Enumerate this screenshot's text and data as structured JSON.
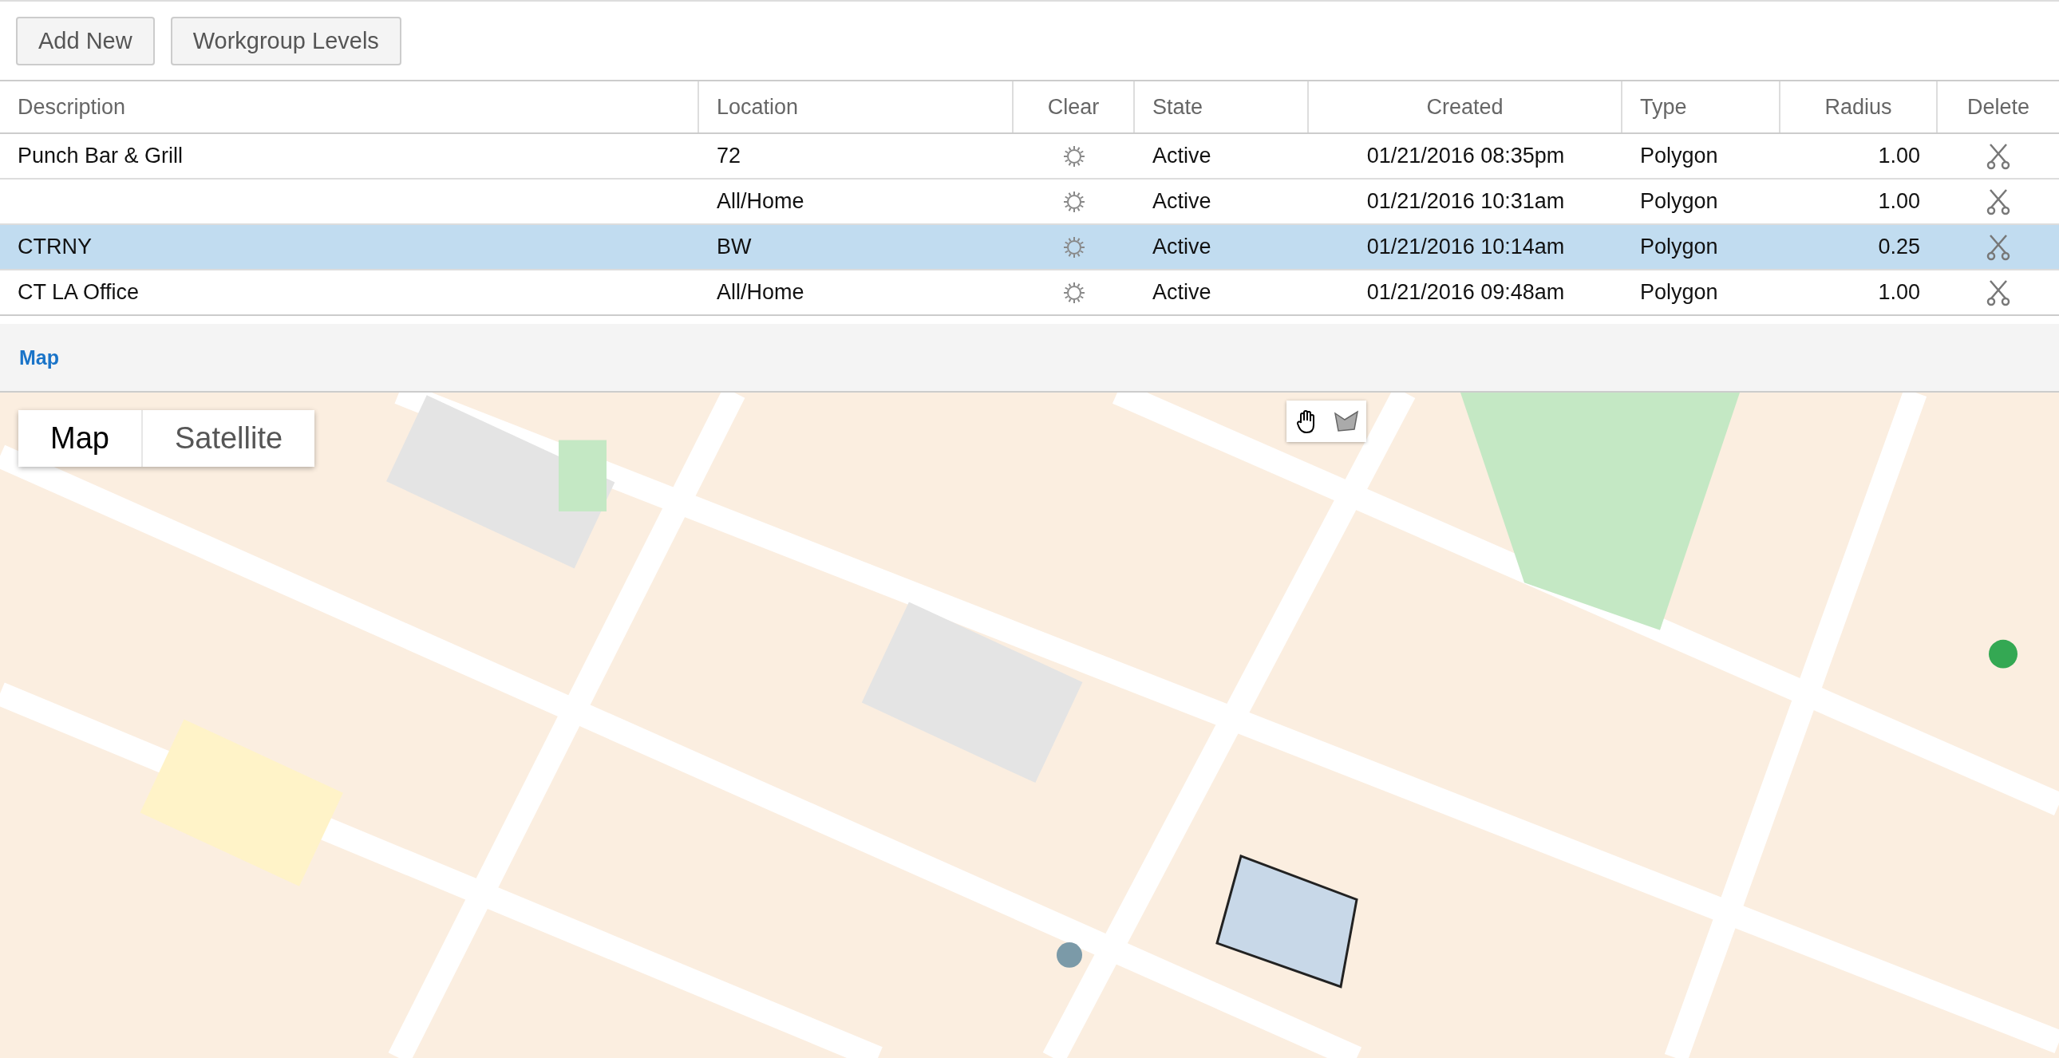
{
  "toolbar": {
    "buttons": [
      "Add New",
      "Workgroup Levels"
    ]
  },
  "table": {
    "columns": [
      "Description",
      "Location",
      "Clear",
      "State",
      "Created",
      "Type",
      "Radius",
      "Delete"
    ],
    "rows": [
      {
        "description": "Punch Bar & Grill",
        "location": "72",
        "state": "Active",
        "created": "01/21/2016 08:35pm",
        "type": "Polygon",
        "radius": "1.00",
        "selected": false
      },
      {
        "description": "",
        "location": "All/Home",
        "state": "Active",
        "created": "01/21/2016 10:31am",
        "type": "Polygon",
        "radius": "1.00",
        "selected": false
      },
      {
        "description": "CTRNY",
        "location": "BW",
        "state": "Active",
        "created": "01/21/2016 10:14am",
        "type": "Polygon",
        "radius": "0.25",
        "selected": true
      },
      {
        "description": "CT LA Office",
        "location": "All/Home",
        "state": "Active",
        "created": "01/21/2016 09:48am",
        "type": "Polygon",
        "radius": "1.00",
        "selected": false
      }
    ]
  },
  "map_section": {
    "title": "Map",
    "map_type_control": [
      {
        "label": "Map",
        "selected": true
      },
      {
        "label": "Satellite",
        "selected": false
      }
    ]
  }
}
